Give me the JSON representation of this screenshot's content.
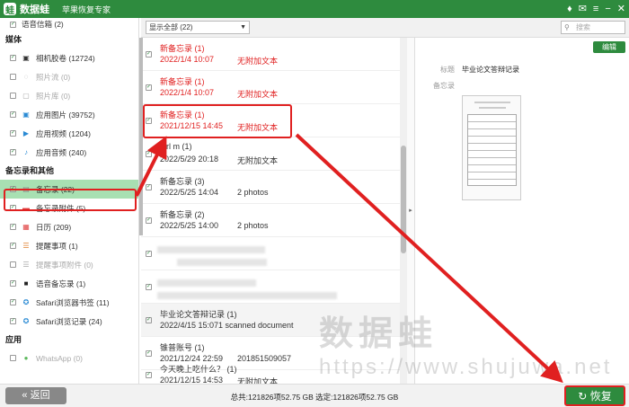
{
  "app": {
    "name": "数据蛙",
    "subtitle": "苹果恢复专家",
    "logo_glyph": "蛙",
    "brand_color": "#2e8b3e",
    "accent_color": "#e02020"
  },
  "titlebar_icons": [
    "diamond-icon",
    "chat-icon",
    "menu-icon",
    "minimize-icon",
    "close-icon"
  ],
  "sidebar": {
    "top_item": "语音信箱 (2)",
    "sections": [
      {
        "title": "媒体",
        "items": [
          {
            "label": "相机胶卷 (12724)",
            "enabled": true
          },
          {
            "label": "照片流 (0)",
            "enabled": false
          },
          {
            "label": "照片库 (0)",
            "enabled": false
          },
          {
            "label": "应用图片 (39752)",
            "enabled": true
          },
          {
            "label": "应用视频 (1204)",
            "enabled": true
          },
          {
            "label": "应用音频 (240)",
            "enabled": true
          }
        ]
      },
      {
        "title": "备忘录和其他",
        "items": [
          {
            "label": "备忘录 (22)",
            "enabled": true,
            "selected": true
          },
          {
            "label": "备忘录附件 (5)",
            "enabled": true
          },
          {
            "label": "日历 (209)",
            "enabled": true
          },
          {
            "label": "提醒事项 (1)",
            "enabled": true
          },
          {
            "label": "提醒事项附件 (0)",
            "enabled": false
          },
          {
            "label": "语音备忘录 (1)",
            "enabled": true
          },
          {
            "label": "Safari浏览器书签 (11)",
            "enabled": true
          },
          {
            "label": "Safari浏览记录 (24)",
            "enabled": true
          }
        ]
      },
      {
        "title": "应用",
        "items": [
          {
            "label": "WhatsApp (0)",
            "enabled": false
          }
        ]
      }
    ]
  },
  "toolbar": {
    "filter_value": "显示全部 (22)",
    "search_placeholder": "搜索"
  },
  "list": [
    {
      "title": "新备忘录 (1)",
      "date": "2022/1/4 10:07",
      "detail": "无附加文本",
      "red": true
    },
    {
      "title": "新备忘录 (1)",
      "date": "2022/1/4 10:07",
      "detail": "无附加文本",
      "red": true
    },
    {
      "title": "新备忘录 (1)",
      "date": "2021/12/15 14:45",
      "detail": "无附加文本",
      "red": true
    },
    {
      "title": "ctrl m (1)",
      "date": "2022/5/29 20:18",
      "detail": "无附加文本",
      "red": false
    },
    {
      "title": "新备忘录 (3)",
      "date": "2022/5/25 14:04",
      "detail": "2 photos",
      "red": false
    },
    {
      "title": "新备忘录 (2)",
      "date": "2022/5/25 14:00",
      "detail": "2 photos",
      "red": false
    },
    {
      "title": "",
      "date": "",
      "detail": "",
      "red": false
    },
    {
      "title": "",
      "date": "",
      "detail": "",
      "red": false
    },
    {
      "title": "毕业论文答辩记录 (1)",
      "date": "2022/4/15 15:07",
      "detail": "1 scanned document",
      "red": false
    },
    {
      "title": "锥普账号 (1)",
      "date": "2021/12/24 22:59",
      "detail": "201851509057",
      "red": false
    },
    {
      "title": "今天晚上吃什么？ (1)",
      "date": "2021/12/15 14:53",
      "detail": "无附加文本",
      "red": false
    }
  ],
  "detail": {
    "edit_label": "编辑",
    "title_label": "标题",
    "title_value": "毕业论文答辩记录",
    "notes_label": "备忘录"
  },
  "bottom": {
    "back_label": "返回",
    "status": "总共:121826项52.75 GB 选定:121826项52.75 GB",
    "recover_label": "恢复"
  },
  "watermark": {
    "cn": "数据蛙",
    "url": "https://www.shujuwa.net"
  }
}
